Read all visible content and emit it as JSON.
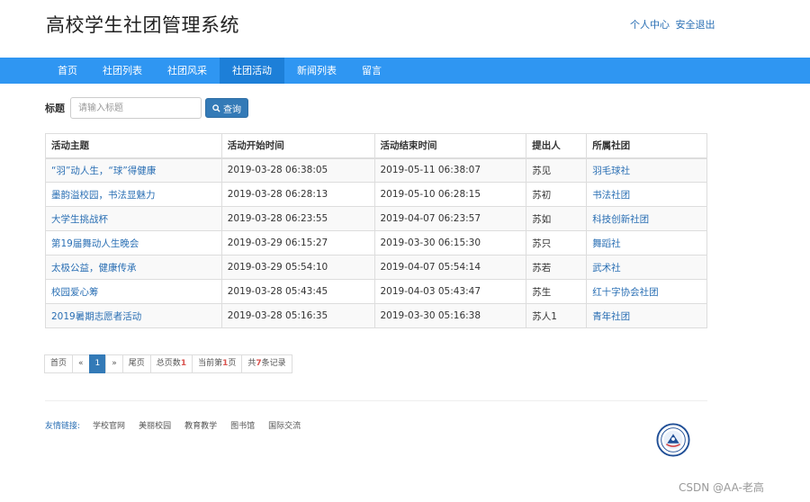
{
  "header": {
    "site_title": "高校学生社团管理系统",
    "user_center": "个人中心",
    "logout": "安全退出"
  },
  "nav": {
    "items": [
      {
        "label": "首页"
      },
      {
        "label": "社团列表"
      },
      {
        "label": "社团风采"
      },
      {
        "label": "社团活动"
      },
      {
        "label": "新闻列表"
      },
      {
        "label": "留言"
      }
    ],
    "active_index": 3
  },
  "search": {
    "label": "标题",
    "placeholder": "请输入标题",
    "button_label": "查询"
  },
  "table": {
    "columns": [
      "活动主题",
      "活动开始时间",
      "活动结束时间",
      "提出人",
      "所属社团"
    ],
    "rows": [
      {
        "topic": "“羽”动人生，“球”得健康",
        "start": "2019-03-28 06:38:05",
        "end": "2019-05-11 06:38:07",
        "proposer": "苏见",
        "club": "羽毛球社"
      },
      {
        "topic": "墨韵溢校园，书法显魅力",
        "start": "2019-03-28 06:28:13",
        "end": "2019-05-10 06:28:15",
        "proposer": "苏初",
        "club": "书法社团"
      },
      {
        "topic": "大学生挑战杯",
        "start": "2019-03-28 06:23:55",
        "end": "2019-04-07 06:23:57",
        "proposer": "苏如",
        "club": "科技创新社团"
      },
      {
        "topic": "第19届舞动人生晚会",
        "start": "2019-03-29 06:15:27",
        "end": "2019-03-30 06:15:30",
        "proposer": "苏只",
        "club": "舞蹈社"
      },
      {
        "topic": "太极公益，健康传承",
        "start": "2019-03-29 05:54:10",
        "end": "2019-04-07 05:54:14",
        "proposer": "苏若",
        "club": "武术社"
      },
      {
        "topic": "校园爱心筹",
        "start": "2019-03-28 05:43:45",
        "end": "2019-04-03 05:43:47",
        "proposer": "苏生",
        "club": "红十字协会社团"
      },
      {
        "topic": "2019暑期志愿者活动",
        "start": "2019-03-28 05:16:35",
        "end": "2019-03-30 05:16:38",
        "proposer": "苏人1",
        "club": "青年社团"
      }
    ]
  },
  "pager": {
    "first": "首页",
    "prev": "«",
    "current_page": "1",
    "next": "»",
    "last": "尾页",
    "total_pages_prefix": "总页数",
    "total_pages": "1",
    "current_prefix": "当前第",
    "current_num": "1",
    "current_suffix": "页",
    "total_prefix": "共",
    "total_records": "7",
    "total_suffix": "条记录"
  },
  "footer": {
    "links_label": "友情链接:",
    "links": [
      "学校官网",
      "美丽校园",
      "教育教学",
      "图书馆",
      "国际交流"
    ]
  },
  "watermark": "CSDN @AA-老高",
  "colors": {
    "navbar": "#2f96f2",
    "nav_active": "#1d7fd8",
    "link": "#2a6fb4",
    "primary_button": "#337ab7"
  }
}
